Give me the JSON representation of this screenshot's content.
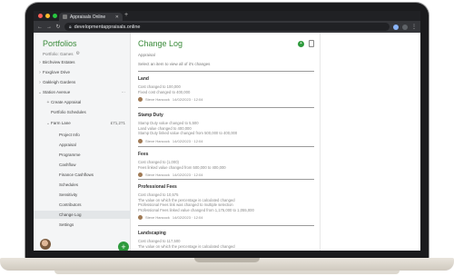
{
  "browser": {
    "tab_title": "Appraisals Online",
    "url": "developmentappraisals.online"
  },
  "sidebar": {
    "title": "Portfolios",
    "subtitle": "Portfolio: Games",
    "items": [
      {
        "label": "Birchview Estates",
        "caret": "›",
        "level": 0
      },
      {
        "label": "Foxglove Drive",
        "caret": "›",
        "level": 0
      },
      {
        "label": "Oakleigh Gardens",
        "caret": "›",
        "level": 0
      },
      {
        "label": "Station Avenue",
        "caret": "⌄",
        "level": 0,
        "right": "···"
      },
      {
        "label": "Create Appraisal",
        "caret": "+",
        "level": 1
      },
      {
        "label": "Portfolio Schedules",
        "caret": "",
        "level": 1
      },
      {
        "label": "Farm Lane",
        "caret": "⌄",
        "level": 1,
        "right": "£71,271"
      },
      {
        "label": "Project Info",
        "caret": "",
        "level": 2
      },
      {
        "label": "Appraisal",
        "caret": "",
        "level": 2
      },
      {
        "label": "Programme",
        "caret": "",
        "level": 2
      },
      {
        "label": "Cashflow",
        "caret": "",
        "level": 2
      },
      {
        "label": "Finance Cashflows",
        "caret": "",
        "level": 2
      },
      {
        "label": "Schedules",
        "caret": "",
        "level": 2
      },
      {
        "label": "Sensitivity",
        "caret": "",
        "level": 2
      },
      {
        "label": "Contributors",
        "caret": "",
        "level": 2
      },
      {
        "label": "Change Log",
        "caret": "",
        "level": 2,
        "selected": true
      },
      {
        "label": "Settings",
        "caret": "",
        "level": 2
      }
    ]
  },
  "main": {
    "title": "Change Log",
    "section": "Appraisal",
    "hint": "Select an item to view all of it's changes",
    "entries": [
      {
        "title": "Land",
        "lines": [
          "Cost changed to 100,000",
          "Fixed cost changed to 400,000"
        ],
        "author": "Steve Hancock",
        "date": "14/02/2023 · 12:04"
      },
      {
        "title": "Stamp Duty",
        "lines": [
          "Stamp Duty value changed to 5,500",
          "Land value changed to 400,000",
          "Stamp Duty linked value changed from 500,000 to 400,000"
        ],
        "author": "Steve Hancock",
        "date": "14/02/2023 · 12:04"
      },
      {
        "title": "Fees",
        "lines": [
          "Cost changed to (1,000)",
          "Fees linked value changed from 500,000 to 400,000"
        ],
        "author": "Steve Hancock",
        "date": "14/02/2023 · 12:04"
      },
      {
        "title": "Professional Fees",
        "lines": [
          "Cost changed to 10,575",
          "The value on which the percentage is calculated changed",
          "Professional Fees link was changed to multiple selection",
          "Professional Fees linked value changed from 1,175,000 to 1,055,000"
        ],
        "author": "Steve Hancock",
        "date": "14/02/2023 · 12:04"
      },
      {
        "title": "Landscaping",
        "lines": [
          "Cost changed to 117,500",
          "The value on which the percentage is calculated changed"
        ],
        "author": "",
        "date": ""
      }
    ]
  },
  "colors": {
    "accent": "#3a8b3a",
    "fab": "#2e9a3c",
    "sidebar_bg": "#f4f5f6"
  }
}
